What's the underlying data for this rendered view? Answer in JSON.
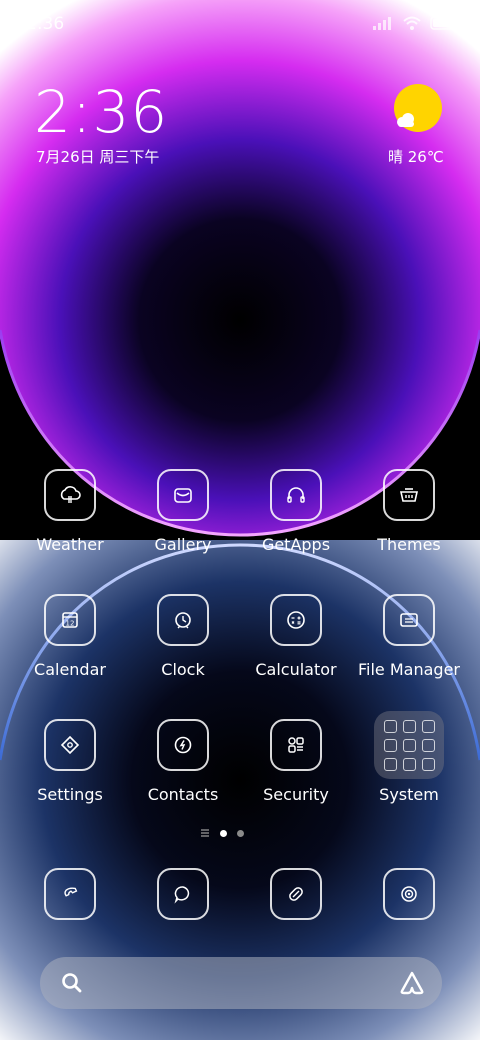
{
  "status_bar": {
    "time": "2:36"
  },
  "lock_clock": {
    "time": "2:36",
    "date": "7月26日 周三下午"
  },
  "weather_widget": {
    "text": "晴 26℃"
  },
  "apps": [
    {
      "label": "Weather",
      "icon": "cloud-icon"
    },
    {
      "label": "Gallery",
      "icon": "gallery-icon"
    },
    {
      "label": "GetApps",
      "icon": "headphones-icon"
    },
    {
      "label": "Themes",
      "icon": "basket-icon"
    },
    {
      "label": "Calendar",
      "icon": "calendar-icon",
      "badge": "12"
    },
    {
      "label": "Clock",
      "icon": "alarm-clock-icon"
    },
    {
      "label": "Calculator",
      "icon": "calculator-icon"
    },
    {
      "label": "File Manager",
      "icon": "folder-icon"
    },
    {
      "label": "Settings",
      "icon": "gear-diamond-icon"
    },
    {
      "label": "Contacts",
      "icon": "contacts-icon"
    },
    {
      "label": "Security",
      "icon": "shield-grid-icon"
    },
    {
      "label": "System",
      "icon": "folder-group-icon"
    }
  ],
  "page_indicator": {
    "pages": 2,
    "current": 1
  },
  "dock": [
    "phone-icon",
    "messages-icon",
    "browser-icon",
    "camera-icon"
  ],
  "colors": {
    "accent_magenta": "#d52cf0",
    "accent_purple": "#5b12c9",
    "sun": "#ffd400"
  }
}
